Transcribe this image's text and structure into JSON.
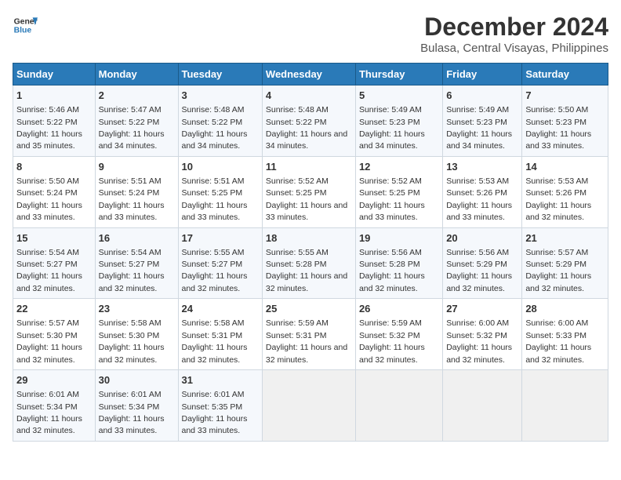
{
  "app": {
    "name_line1": "General",
    "name_line2": "Blue"
  },
  "title": "December 2024",
  "subtitle": "Bulasa, Central Visayas, Philippines",
  "days_of_week": [
    "Sunday",
    "Monday",
    "Tuesday",
    "Wednesday",
    "Thursday",
    "Friday",
    "Saturday"
  ],
  "weeks": [
    [
      {
        "day": 1,
        "sunrise": "5:46 AM",
        "sunset": "5:22 PM",
        "daylight": "11 hours and 35 minutes."
      },
      {
        "day": 2,
        "sunrise": "5:47 AM",
        "sunset": "5:22 PM",
        "daylight": "11 hours and 34 minutes."
      },
      {
        "day": 3,
        "sunrise": "5:48 AM",
        "sunset": "5:22 PM",
        "daylight": "11 hours and 34 minutes."
      },
      {
        "day": 4,
        "sunrise": "5:48 AM",
        "sunset": "5:22 PM",
        "daylight": "11 hours and 34 minutes."
      },
      {
        "day": 5,
        "sunrise": "5:49 AM",
        "sunset": "5:23 PM",
        "daylight": "11 hours and 34 minutes."
      },
      {
        "day": 6,
        "sunrise": "5:49 AM",
        "sunset": "5:23 PM",
        "daylight": "11 hours and 34 minutes."
      },
      {
        "day": 7,
        "sunrise": "5:50 AM",
        "sunset": "5:23 PM",
        "daylight": "11 hours and 33 minutes."
      }
    ],
    [
      {
        "day": 8,
        "sunrise": "5:50 AM",
        "sunset": "5:24 PM",
        "daylight": "11 hours and 33 minutes."
      },
      {
        "day": 9,
        "sunrise": "5:51 AM",
        "sunset": "5:24 PM",
        "daylight": "11 hours and 33 minutes."
      },
      {
        "day": 10,
        "sunrise": "5:51 AM",
        "sunset": "5:25 PM",
        "daylight": "11 hours and 33 minutes."
      },
      {
        "day": 11,
        "sunrise": "5:52 AM",
        "sunset": "5:25 PM",
        "daylight": "11 hours and 33 minutes."
      },
      {
        "day": 12,
        "sunrise": "5:52 AM",
        "sunset": "5:25 PM",
        "daylight": "11 hours and 33 minutes."
      },
      {
        "day": 13,
        "sunrise": "5:53 AM",
        "sunset": "5:26 PM",
        "daylight": "11 hours and 33 minutes."
      },
      {
        "day": 14,
        "sunrise": "5:53 AM",
        "sunset": "5:26 PM",
        "daylight": "11 hours and 32 minutes."
      }
    ],
    [
      {
        "day": 15,
        "sunrise": "5:54 AM",
        "sunset": "5:27 PM",
        "daylight": "11 hours and 32 minutes."
      },
      {
        "day": 16,
        "sunrise": "5:54 AM",
        "sunset": "5:27 PM",
        "daylight": "11 hours and 32 minutes."
      },
      {
        "day": 17,
        "sunrise": "5:55 AM",
        "sunset": "5:27 PM",
        "daylight": "11 hours and 32 minutes."
      },
      {
        "day": 18,
        "sunrise": "5:55 AM",
        "sunset": "5:28 PM",
        "daylight": "11 hours and 32 minutes."
      },
      {
        "day": 19,
        "sunrise": "5:56 AM",
        "sunset": "5:28 PM",
        "daylight": "11 hours and 32 minutes."
      },
      {
        "day": 20,
        "sunrise": "5:56 AM",
        "sunset": "5:29 PM",
        "daylight": "11 hours and 32 minutes."
      },
      {
        "day": 21,
        "sunrise": "5:57 AM",
        "sunset": "5:29 PM",
        "daylight": "11 hours and 32 minutes."
      }
    ],
    [
      {
        "day": 22,
        "sunrise": "5:57 AM",
        "sunset": "5:30 PM",
        "daylight": "11 hours and 32 minutes."
      },
      {
        "day": 23,
        "sunrise": "5:58 AM",
        "sunset": "5:30 PM",
        "daylight": "11 hours and 32 minutes."
      },
      {
        "day": 24,
        "sunrise": "5:58 AM",
        "sunset": "5:31 PM",
        "daylight": "11 hours and 32 minutes."
      },
      {
        "day": 25,
        "sunrise": "5:59 AM",
        "sunset": "5:31 PM",
        "daylight": "11 hours and 32 minutes."
      },
      {
        "day": 26,
        "sunrise": "5:59 AM",
        "sunset": "5:32 PM",
        "daylight": "11 hours and 32 minutes."
      },
      {
        "day": 27,
        "sunrise": "6:00 AM",
        "sunset": "5:32 PM",
        "daylight": "11 hours and 32 minutes."
      },
      {
        "day": 28,
        "sunrise": "6:00 AM",
        "sunset": "5:33 PM",
        "daylight": "11 hours and 32 minutes."
      }
    ],
    [
      {
        "day": 29,
        "sunrise": "6:01 AM",
        "sunset": "5:34 PM",
        "daylight": "11 hours and 32 minutes."
      },
      {
        "day": 30,
        "sunrise": "6:01 AM",
        "sunset": "5:34 PM",
        "daylight": "11 hours and 33 minutes."
      },
      {
        "day": 31,
        "sunrise": "6:01 AM",
        "sunset": "5:35 PM",
        "daylight": "11 hours and 33 minutes."
      },
      null,
      null,
      null,
      null
    ]
  ]
}
